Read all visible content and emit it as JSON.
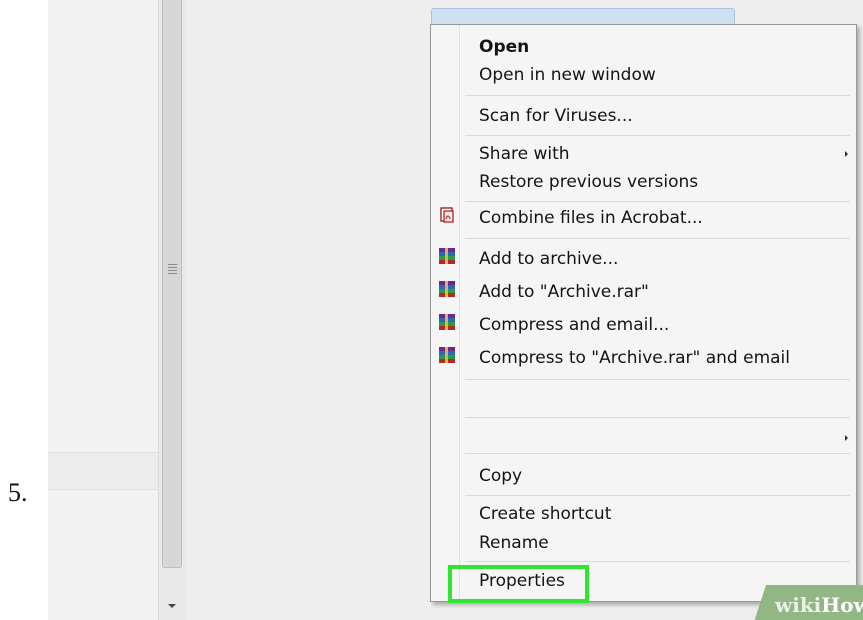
{
  "step": {
    "number": "5."
  },
  "context_menu": {
    "items": [
      {
        "label": "Open",
        "bold": true
      },
      {
        "label": "Open in new window"
      },
      {
        "label": "Scan for Viruses..."
      },
      {
        "label": "Share with",
        "submenu": true
      },
      {
        "label": "Restore previous versions"
      },
      {
        "label": "Combine files in Acrobat...",
        "icon": "acrobat-icon"
      },
      {
        "label": "Add to archive...",
        "icon": "winrar-icon"
      },
      {
        "label": "Add to \"Archive.rar\"",
        "icon": "winrar-icon"
      },
      {
        "label": "Compress and email...",
        "icon": "winrar-icon"
      },
      {
        "label": "Compress to \"Archive.rar\" and email",
        "icon": "winrar-icon"
      },
      {
        "label": "",
        "submenu": true
      },
      {
        "label": "Copy"
      },
      {
        "label": "Create shortcut"
      },
      {
        "label": "Rename"
      },
      {
        "label": "Properties",
        "highlighted": true
      }
    ]
  },
  "watermark": {
    "prefix": "wiki",
    "suffix": "How"
  },
  "colors": {
    "highlight": "#2fe52f",
    "selection": "#cfe0f2",
    "watermark_bg": "#93b784"
  }
}
